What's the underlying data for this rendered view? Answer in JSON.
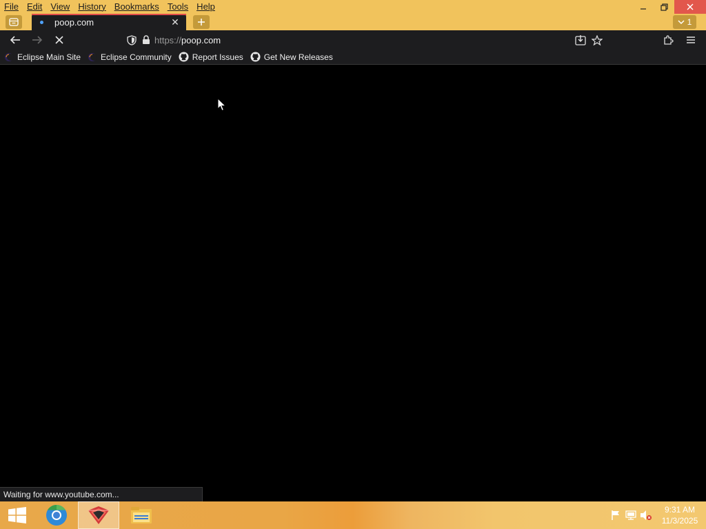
{
  "menu": {
    "items": [
      "File",
      "Edit",
      "View",
      "History",
      "Bookmarks",
      "Tools",
      "Help"
    ]
  },
  "window": {
    "minimize_icon": "minimize-icon",
    "restore_icon": "restore-icon",
    "close_icon": "close-icon"
  },
  "tabs": {
    "active_title": "poop.com",
    "all_tabs_count": "1"
  },
  "navbar": {
    "url_scheme": "https://",
    "url_host": "poop.com"
  },
  "bookmarks": [
    {
      "label": "Eclipse Main Site",
      "icon": "eclipse-icon"
    },
    {
      "label": "Eclipse Community",
      "icon": "eclipse-icon"
    },
    {
      "label": "Report Issues",
      "icon": "github-icon"
    },
    {
      "label": "Get New Releases",
      "icon": "github-icon"
    }
  ],
  "status": {
    "text": "Waiting for www.youtube.com..."
  },
  "taskbar": {
    "time": "9:31 AM",
    "date": "11/3/2025"
  },
  "colors": {
    "frame": "#f1c35c",
    "toolbar": "#1d1d1f",
    "tab_accent": "#e24a4a",
    "close_button": "#e2574c"
  }
}
